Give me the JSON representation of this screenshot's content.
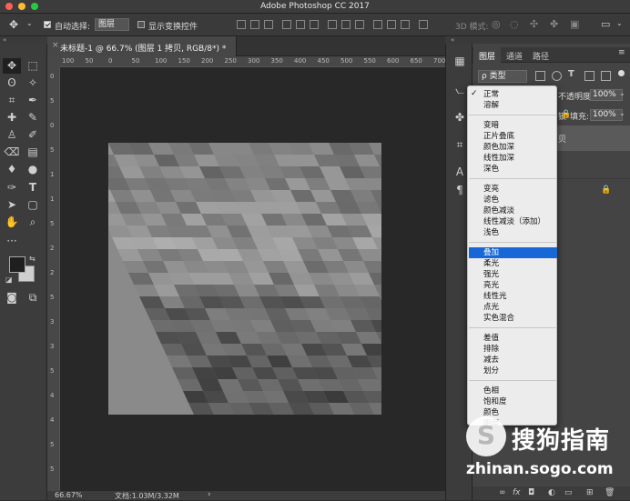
{
  "window": {
    "title": "Adobe Photoshop CC 2017"
  },
  "options_bar": {
    "auto_select_label": "自动选择:",
    "auto_select_checked": true,
    "auto_select_value": "图层",
    "show_transform_label": "显示变换控件",
    "show_transform_checked": false,
    "mode_3d_label": "3D 模式:"
  },
  "document": {
    "tab_label": "未标题-1 @ 66.7% (图层 1 拷贝, RGB/8*) *",
    "close_glyph": "×",
    "zoom": "66.67%",
    "doc_info": "文档:1.03M/3.32M",
    "ruler_marks": [
      "100",
      "50",
      "0",
      "50",
      "100",
      "150",
      "200",
      "250",
      "300",
      "350",
      "400",
      "450",
      "500",
      "550",
      "600",
      "650",
      "700",
      "750"
    ],
    "ruler_marks_v": [
      "0",
      "5",
      "0",
      "5",
      "1",
      "1",
      "5",
      "2",
      "2",
      "5",
      "3",
      "3",
      "5",
      "4",
      "4",
      "5",
      "5"
    ]
  },
  "layers_panel": {
    "tabs": [
      "图层",
      "通道",
      "路径"
    ],
    "active_tab": 0,
    "filter_label": "ρ 类型",
    "opacity_label": "不透明度:",
    "opacity_value": "100%",
    "lock_label": "锁",
    "fill_label": "填充:",
    "fill_value": "100%",
    "layer_name_fragment": "贝"
  },
  "blend_menu": {
    "checked_item": "正常",
    "groups": [
      [
        "正常",
        "溶解"
      ],
      [
        "变暗",
        "正片叠底",
        "颜色加深",
        "线性加深",
        "深色"
      ],
      [
        "变亮",
        "滤色",
        "颜色减淡",
        "线性减淡（添加）",
        "浅色"
      ],
      [
        "叠加",
        "柔光",
        "强光",
        "亮光",
        "线性光",
        "点光",
        "实色混合"
      ],
      [
        "差值",
        "排除",
        "减去",
        "划分"
      ],
      [
        "色相",
        "饱和度",
        "颜色",
        "明度"
      ]
    ],
    "selected_item": "叠加"
  },
  "watermark": {
    "logo": "S",
    "brand": "搜狗指南",
    "url": "zhinan.sogo.com"
  },
  "colors": {
    "menu_selected": "#1768d6",
    "foreground": "#1f1f1f",
    "background_swatch": "#cfcfcf"
  },
  "icons": [
    "move-icon",
    "marquee-icon",
    "lasso-icon",
    "magic-wand-icon",
    "crop-icon",
    "eyedropper-icon",
    "healing-icon",
    "brush-icon",
    "stamp-icon",
    "history-brush-icon",
    "eraser-icon",
    "gradient-icon",
    "blur-icon",
    "dodge-icon",
    "pen-icon",
    "type-icon",
    "path-select-icon",
    "shape-icon",
    "hand-icon",
    "zoom-icon"
  ]
}
